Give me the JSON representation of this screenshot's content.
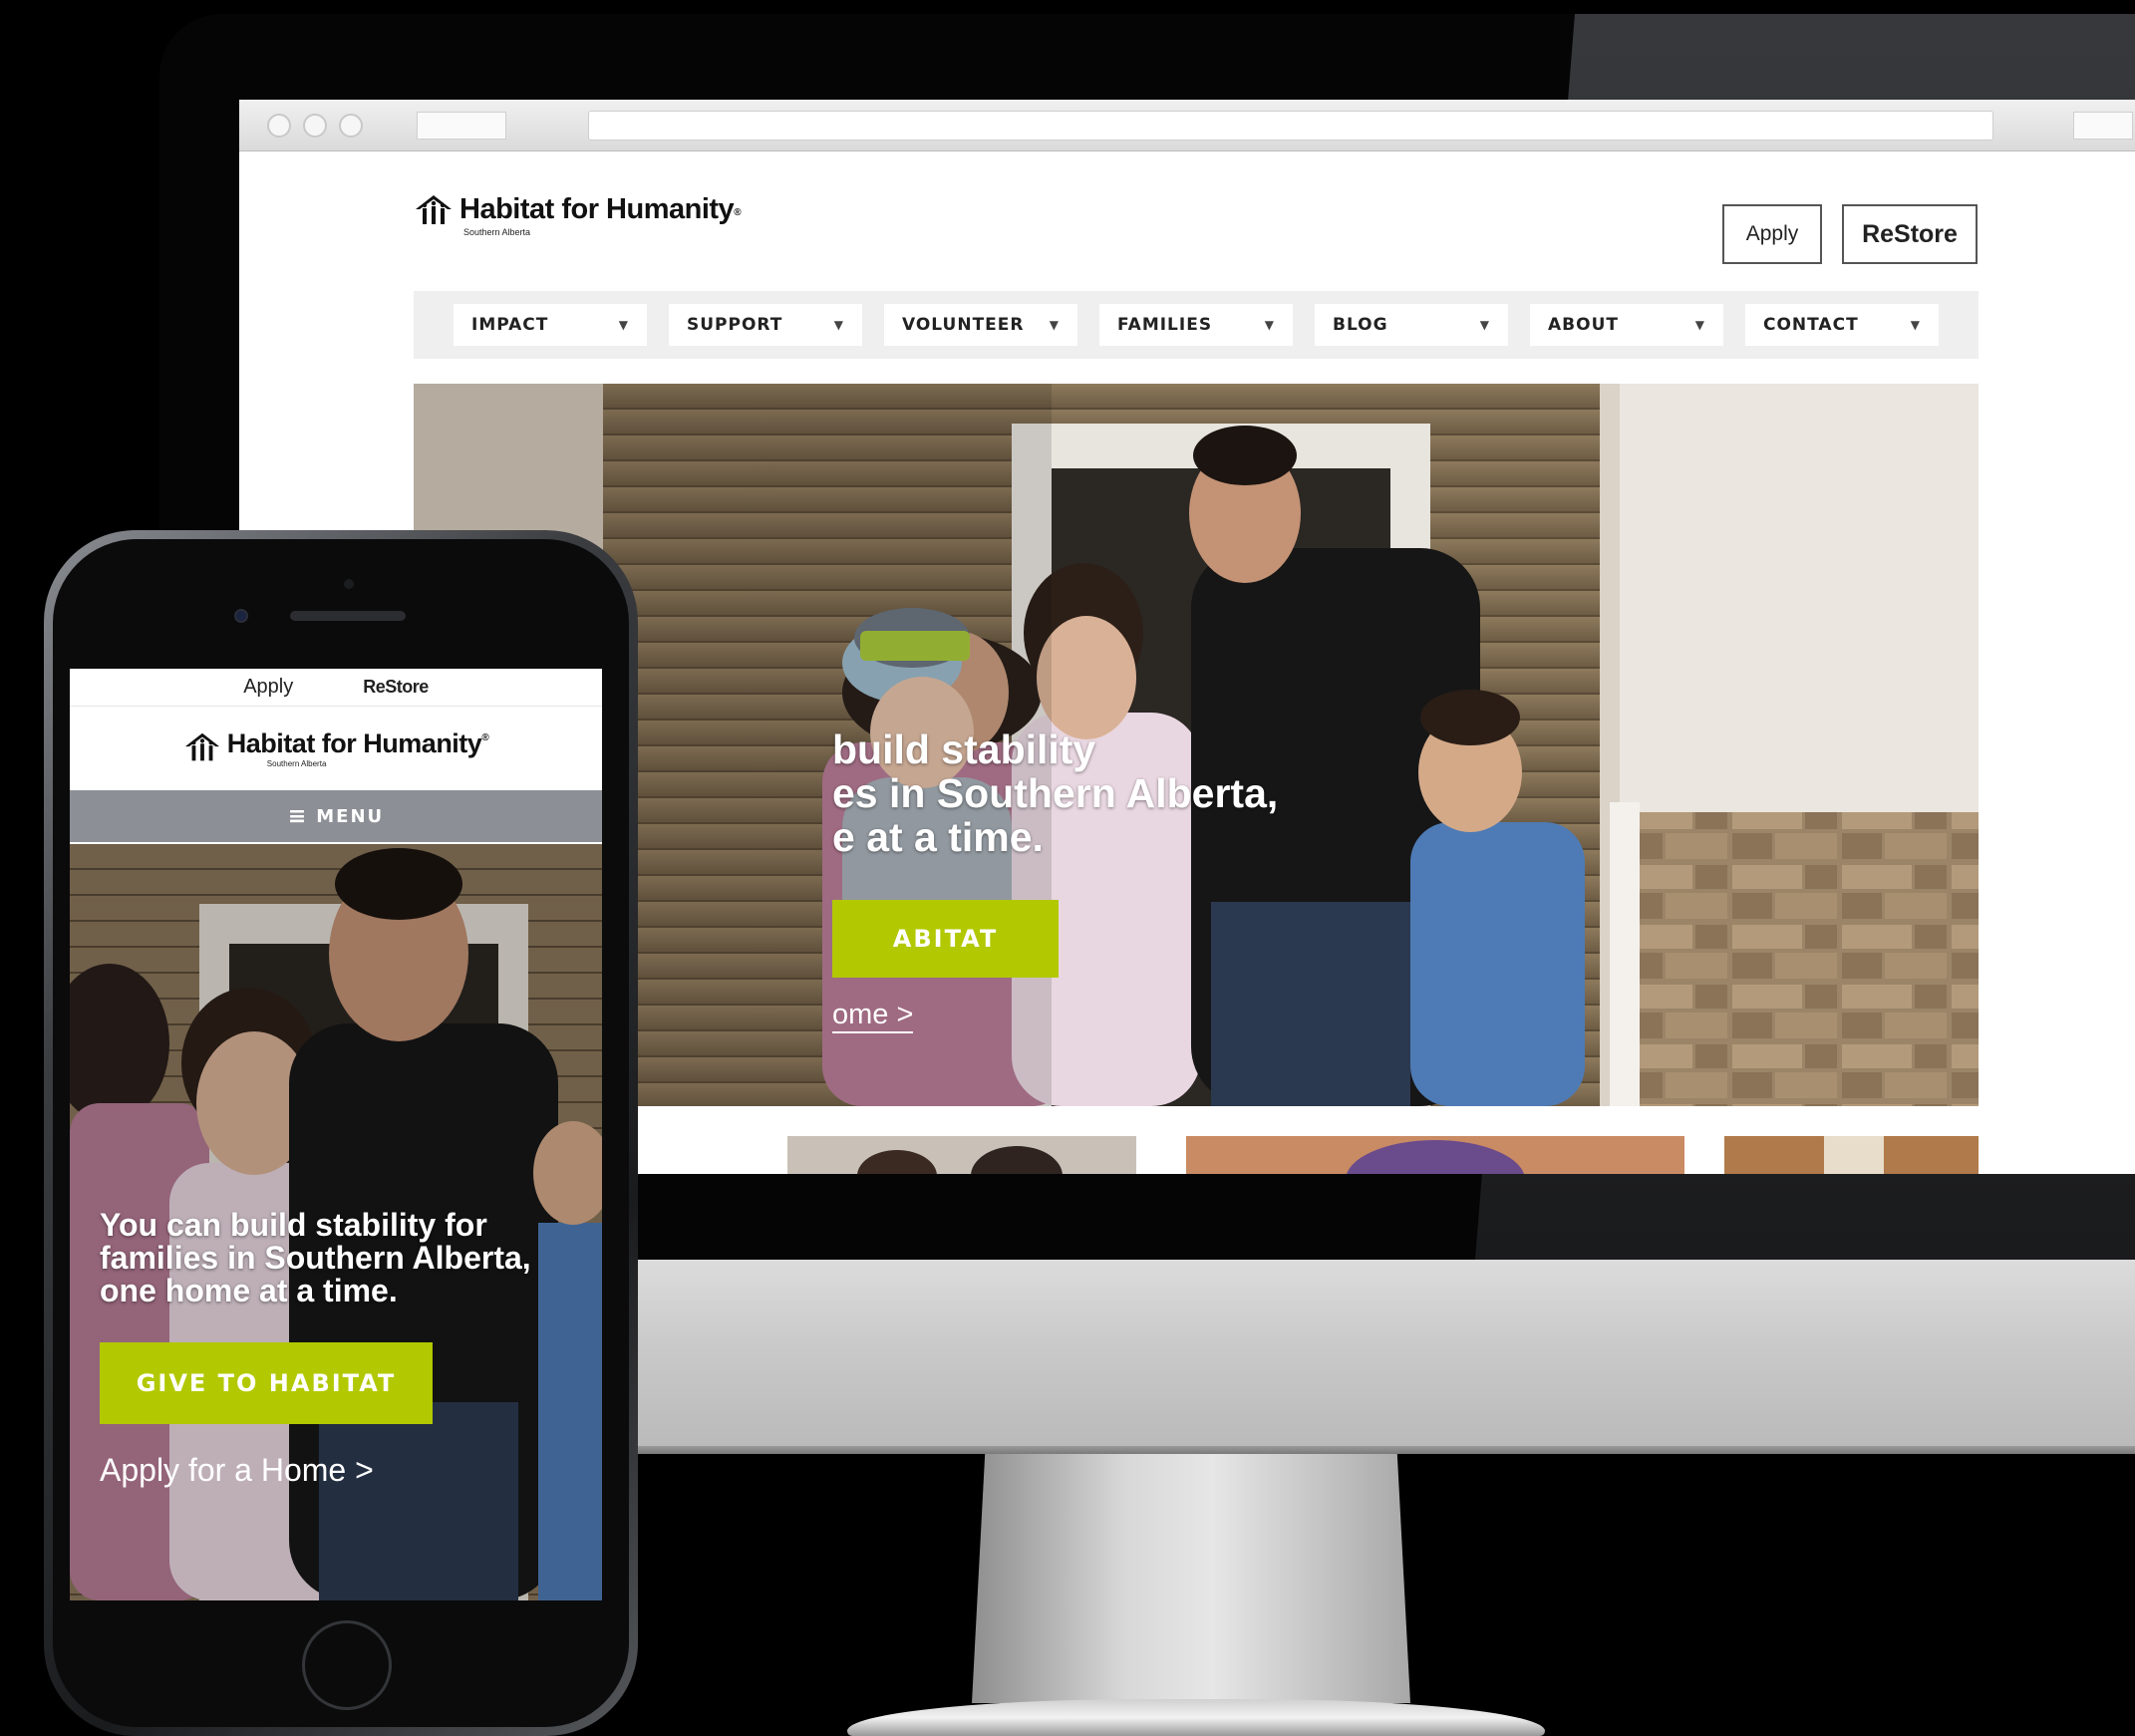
{
  "colors": {
    "accent_green": "#b2c800",
    "nav_background": "#efefef",
    "mobile_menu_bar": "#8c9096"
  },
  "desktop": {
    "logo": {
      "name": "Habitat for Humanity",
      "registered_mark": "®",
      "subtitle": "Southern Alberta",
      "icon": "house-people-icon"
    },
    "header_buttons": {
      "apply": "Apply",
      "restore": "ReStore"
    },
    "nav": [
      {
        "label": "IMPACT"
      },
      {
        "label": "SUPPORT"
      },
      {
        "label": "VOLUNTEER"
      },
      {
        "label": "FAMILIES"
      },
      {
        "label": "BLOG"
      },
      {
        "label": "ABOUT"
      },
      {
        "label": "CONTACT"
      }
    ],
    "nav_caret_icon": "chevron-down-icon",
    "hero": {
      "headline_line1": "build stability",
      "headline_line2": "es in Southern Alberta,",
      "headline_line3": "e at a time.",
      "cta": "ABITAT",
      "link": "ome >"
    }
  },
  "mobile": {
    "top_links": {
      "apply": "Apply",
      "restore": "ReStore"
    },
    "logo": {
      "name": "Habitat for Humanity",
      "registered_mark": "®",
      "subtitle": "Southern Alberta",
      "icon": "house-people-icon"
    },
    "menu_label": "MENU",
    "menu_icon": "hamburger-icon",
    "hero": {
      "headline_line1": "You can build stability for",
      "headline_line2": "families in Southern Alberta,",
      "headline_line3": "one home at a time.",
      "cta": "GIVE TO HABITAT",
      "link": "Apply for a Home >"
    }
  }
}
